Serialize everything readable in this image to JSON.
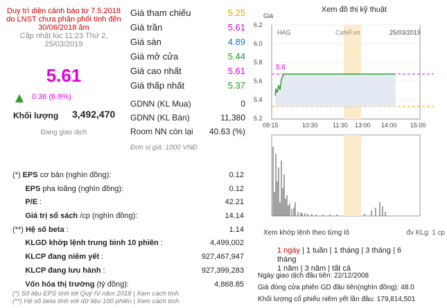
{
  "warning": "Duy trì diện cảnh báo từ 7.5.2018 do LNST chưa phân phối tính đến 30/06/2018 âm",
  "updated": "Cập nhật lúc 11:23 Thứ 2, 25/03/2019",
  "price": "5.61",
  "change": "0.36 (6.9%)",
  "volume_label": "Khối lượng",
  "volume": "3,492,470",
  "trading_status": "Đang giao dịch",
  "price_table": [
    {
      "label": "Giá tham chiếu",
      "value": "5.25",
      "color": "#e6a200"
    },
    {
      "label": "Giá trần",
      "value": "5.61",
      "color": "#e000e0"
    },
    {
      "label": "Giá sàn",
      "value": "4.89",
      "color": "#1f6fd1"
    },
    {
      "label": "Giá mở cửa",
      "value": "5.44",
      "color": "#1a9a1a"
    },
    {
      "label": "Giá cao nhất",
      "value": "5.61",
      "color": "#e000e0"
    },
    {
      "label": "Giá thấp nhất",
      "value": "5.37",
      "color": "#1a9a1a"
    }
  ],
  "foreign_table": [
    {
      "label": "GDNN (KL Mua)",
      "value": "0"
    },
    {
      "label": "GDNN (KL Bán)",
      "value": "11,380"
    },
    {
      "label": "Room NN còn lại",
      "value": "40.63 (%)"
    }
  ],
  "unit_note": "Đơn vị giá: 1000 VNĐ",
  "metrics": [
    {
      "prefix": "(*)",
      "label": "EPS",
      "rest": "cơ bản (nghìn đồng):",
      "value": "0.12"
    },
    {
      "prefix": "",
      "label": "EPS",
      "rest": "pha loãng (nghìn đồng):",
      "value": "0.12"
    },
    {
      "prefix": "",
      "label": "P/E",
      "rest": ":",
      "value": "42.21"
    },
    {
      "prefix": "",
      "label": "Giá trị sổ sách",
      "rest": "/cp (nghìn đồng):",
      "value": "14.14"
    },
    {
      "prefix": "(**)",
      "label": "Hệ số beta",
      "rest": ":",
      "value": "1.14"
    },
    {
      "prefix": "",
      "label": "KLGD khớp lệnh trung bình 10 phiên",
      "rest": ":",
      "value": "4,499,002"
    },
    {
      "prefix": "",
      "label": "KLCP đang niêm yết",
      "rest": ":",
      "value": "927,467,947"
    },
    {
      "prefix": "",
      "label": "KLCP đang lưu hành",
      "rest": ":",
      "value": "927,399,283"
    },
    {
      "prefix": "",
      "label": "Vốn hóa thị trường",
      "rest": "(tỷ đồng):",
      "value": "4,868.85"
    }
  ],
  "notes": [
    "(*) Số liệu EPS tính tới Quý IV năm 2018 | Xem cách tính",
    "(**) Hệ số beta tính với dữ liệu 100 phiên | Xem cách tính"
  ],
  "tech_title": "Xem đồ thị kỹ thuật",
  "chart": {
    "ylabel": "Giá",
    "ticker": "HAG",
    "source": "CafeF.vn",
    "date": "25/03/2019",
    "yticks": [
      "6.2",
      "6.0",
      "5.8",
      "5.6",
      "5.4",
      "5.2"
    ],
    "xticks": [
      "09:15",
      "10:30",
      "11:30",
      "13:00",
      "14:00",
      "15:00"
    ],
    "ceiling_label": "5.6",
    "ref_label": "5.3"
  },
  "chart_foot_left": "Xem khớp lệnh theo từng lô",
  "chart_foot_right": "đv KLg: 1 cp",
  "periods_line1": [
    "1 ngày",
    "1 tuần",
    "1 tháng",
    "3 tháng",
    "6 tháng"
  ],
  "periods_line2": [
    "1 năm",
    "3 năm",
    "tất cả"
  ],
  "first_trade_date": "Ngày giao dịch đầu tiên: 22/12/2008",
  "first_close": "Giá đóng cửa phiên GD đầu tiên(nghìn đồng): 48.0",
  "first_volume": "Khối lượng cổ phiếu niêm yết lần đầu: 179,814,501",
  "colors": {
    "accent": "#e000e0",
    "up": "#2e9e2e",
    "warning": "#cc0000",
    "highlight": "#fbecc9"
  }
}
